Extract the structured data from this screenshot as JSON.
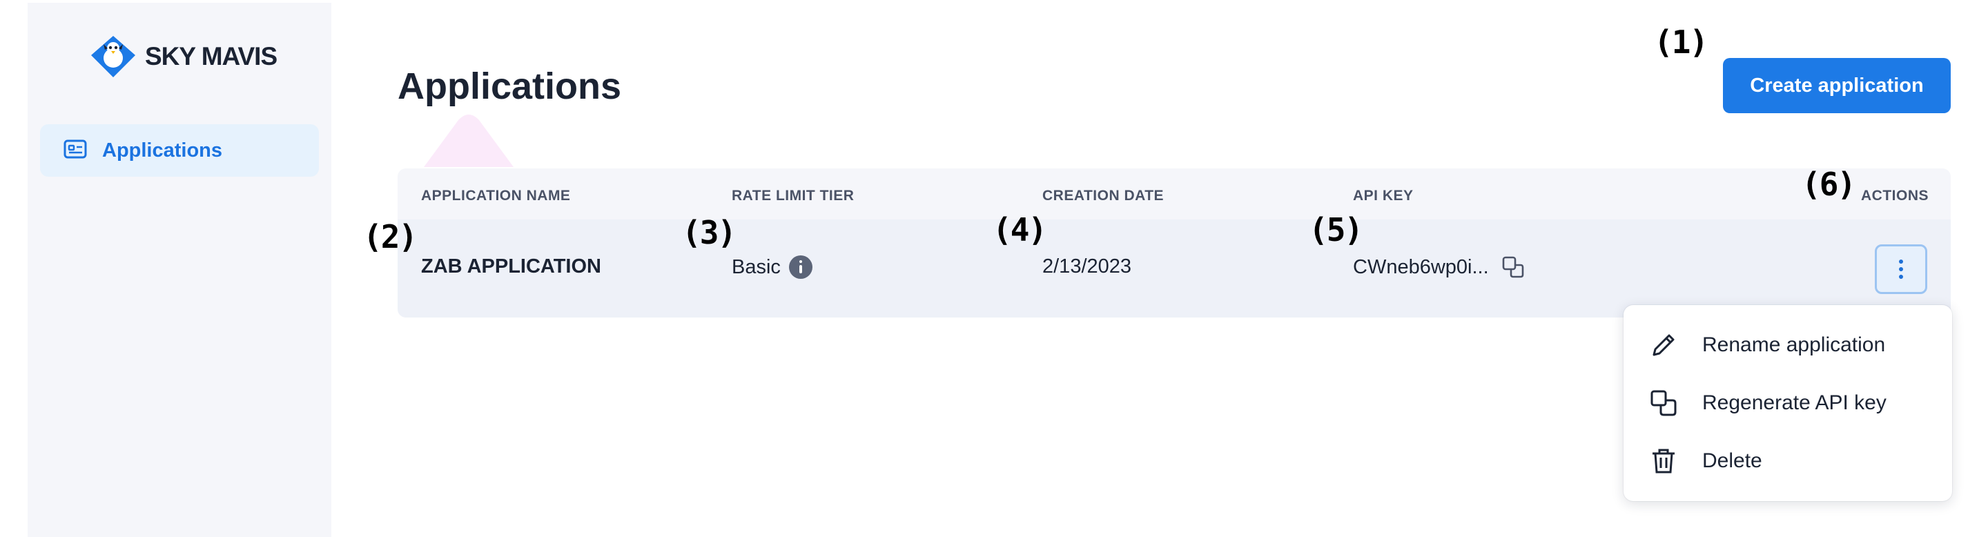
{
  "brand": {
    "name": "SKY MAVIS",
    "accent": "#1d7ae6"
  },
  "sidebar": {
    "items": [
      {
        "label": "Applications",
        "icon": "id-card-icon",
        "active": true
      }
    ]
  },
  "page": {
    "title": "Applications",
    "create_button_label": "Create application"
  },
  "annotations": [
    "(1)",
    "(2)",
    "(3)",
    "(4)",
    "(5)",
    "(6)"
  ],
  "table": {
    "columns": [
      "APPLICATION NAME",
      "RATE LIMIT TIER",
      "CREATION DATE",
      "API KEY",
      "ACTIONS"
    ],
    "rows": [
      {
        "name": "ZAB APPLICATION",
        "tier": "Basic",
        "created": "2/13/2023",
        "api_key": "CWneb6wp0i..."
      }
    ]
  },
  "actions_menu": {
    "items": [
      {
        "label": "Rename application",
        "icon": "pencil-icon"
      },
      {
        "label": "Regenerate API key",
        "icon": "copy-icon"
      },
      {
        "label": "Delete",
        "icon": "trash-icon"
      }
    ]
  }
}
